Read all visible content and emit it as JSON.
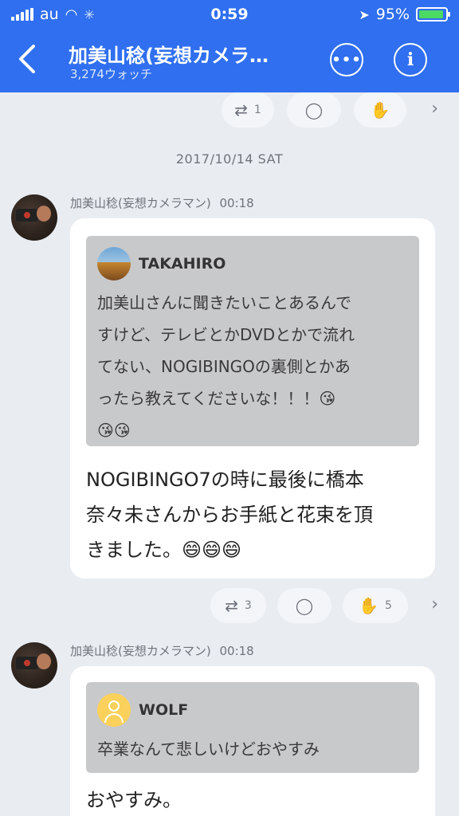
{
  "status_bar": {
    "carrier": "au",
    "time": "0:59",
    "battery_percent": "95%",
    "battery_level": 0.95
  },
  "nav": {
    "title": "加美山稔(妄想カメラ…",
    "subtitle": "3,274ウォッチ",
    "back_icon": "chevron-left-icon",
    "chat_icon": "chat-bubble-icon",
    "info_icon": "info-icon"
  },
  "top_actions": {
    "retweet_count": "1",
    "comment_count": "",
    "clap_count": ""
  },
  "date_separator": "2017/10/14 SAT",
  "posts": [
    {
      "sender": "加美山稔(妄想カメラマン)",
      "time": "00:18",
      "quote_name": "TAKAHIRO",
      "quote_lines": [
        "加美山さんに聞きたいことあるんで",
        "すけど、テレビとかDVDとかで流れ",
        "てない、NOGIBINGOの裏側とかあ",
        "ったら教えてくださいな！！！😘",
        "😘😘"
      ],
      "message_lines": [
        "NOGIBINGO7の時に最後に橋本",
        "奈々未さんからお手紙と花束を頂",
        "きました。😄😄😄"
      ],
      "retweet_count": "3",
      "comment_count": "",
      "clap_count": "5"
    },
    {
      "sender": "加美山稔(妄想カメラマン)",
      "time": "00:18",
      "quote_name": "WOLF",
      "quote_lines": [
        "卒業なんて悲しいけどおやすみ"
      ],
      "message_lines": [
        "おやすみ。"
      ]
    }
  ]
}
